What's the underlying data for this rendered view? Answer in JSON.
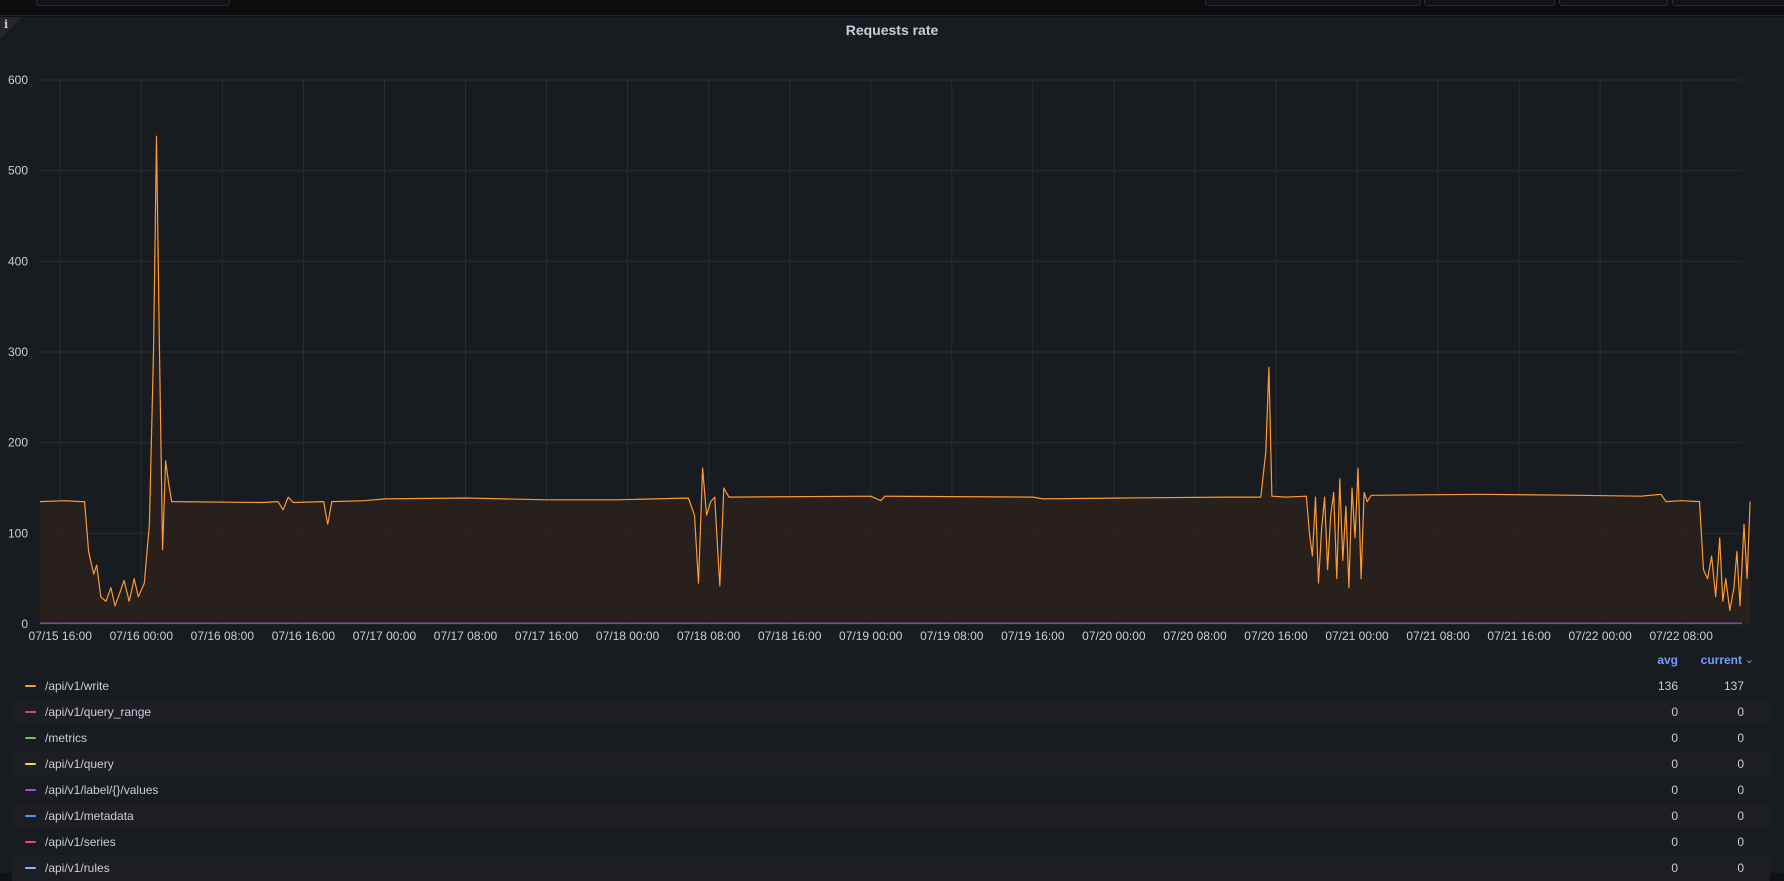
{
  "panel": {
    "title": "Requests rate",
    "info_glyph": "i"
  },
  "legend": {
    "avg_header": "avg",
    "current_header": "current",
    "sort_icon": "chevron-down-icon",
    "rows": [
      {
        "label": "/api/v1/write",
        "color": "#ff9830",
        "avg": "136",
        "current": "137"
      },
      {
        "label": "/api/v1/query_range",
        "color": "#d63e88",
        "avg": "0",
        "current": "0"
      },
      {
        "label": "/metrics",
        "color": "#73bf69",
        "avg": "0",
        "current": "0"
      },
      {
        "label": "/api/v1/query",
        "color": "#fade2a",
        "avg": "0",
        "current": "0"
      },
      {
        "label": "/api/v1/label/{}/values",
        "color": "#a352cc",
        "avg": "0",
        "current": "0"
      },
      {
        "label": "/api/v1/metadata",
        "color": "#5794f2",
        "avg": "0",
        "current": "0"
      },
      {
        "label": "/api/v1/series",
        "color": "#f2495c",
        "avg": "0",
        "current": "0"
      },
      {
        "label": "/api/v1/rules",
        "color": "#8ab8ff",
        "avg": "0",
        "current": "0"
      }
    ]
  },
  "chart_data": {
    "type": "area",
    "title": "Requests rate",
    "ylim": [
      0,
      600
    ],
    "y_ticks": [
      0,
      100,
      200,
      300,
      400,
      500,
      600
    ],
    "x_tick_labels": [
      "07/15 16:00",
      "07/16 00:00",
      "07/16 08:00",
      "07/16 16:00",
      "07/17 00:00",
      "07/17 08:00",
      "07/17 16:00",
      "07/18 00:00",
      "07/18 08:00",
      "07/18 16:00",
      "07/19 00:00",
      "07/19 08:00",
      "07/19 16:00",
      "07/20 00:00",
      "07/20 08:00",
      "07/20 16:00",
      "07/21 00:00",
      "07/21 08:00",
      "07/21 16:00",
      "07/22 00:00",
      "07/22 08:00"
    ],
    "x_range_hours": [
      -2,
      166
    ],
    "grid": true,
    "legend_position": "bottom",
    "series": [
      {
        "name": "/api/v1/write",
        "color": "#ff9830",
        "fill": "#2b211d",
        "points": [
          [
            -2,
            135
          ],
          [
            0.5,
            136
          ],
          [
            2,
            135
          ],
          [
            2.4,
            135
          ],
          [
            2.8,
            80
          ],
          [
            3.3,
            55
          ],
          [
            3.6,
            65
          ],
          [
            4,
            30
          ],
          [
            4.5,
            25
          ],
          [
            5,
            40
          ],
          [
            5.4,
            20
          ],
          [
            5.9,
            35
          ],
          [
            6.3,
            48
          ],
          [
            6.8,
            25
          ],
          [
            7.3,
            50
          ],
          [
            7.7,
            30
          ],
          [
            8.3,
            45
          ],
          [
            8.8,
            110
          ],
          [
            9.2,
            300
          ],
          [
            9.5,
            538
          ],
          [
            9.8,
            300
          ],
          [
            10.1,
            82
          ],
          [
            10.4,
            180
          ],
          [
            10.7,
            155
          ],
          [
            11,
            135
          ],
          [
            20,
            134
          ],
          [
            21.5,
            135
          ],
          [
            22,
            126
          ],
          [
            22.5,
            140
          ],
          [
            23,
            134
          ],
          [
            26,
            135
          ],
          [
            26.4,
            110
          ],
          [
            26.8,
            135
          ],
          [
            30,
            136
          ],
          [
            32,
            138
          ],
          [
            40,
            139
          ],
          [
            48,
            137
          ],
          [
            55,
            137
          ],
          [
            62,
            139
          ],
          [
            62.6,
            120
          ],
          [
            63,
            45
          ],
          [
            63.4,
            172
          ],
          [
            63.8,
            120
          ],
          [
            64.2,
            135
          ],
          [
            64.6,
            140
          ],
          [
            65.1,
            42
          ],
          [
            65.5,
            150
          ],
          [
            66,
            140
          ],
          [
            80,
            141
          ],
          [
            81,
            136
          ],
          [
            81.4,
            141
          ],
          [
            96,
            140
          ],
          [
            97,
            138
          ],
          [
            105,
            139
          ],
          [
            115,
            140
          ],
          [
            118.5,
            140
          ],
          [
            119,
            190
          ],
          [
            119.3,
            283
          ],
          [
            119.6,
            141
          ],
          [
            121,
            140
          ],
          [
            123,
            141
          ],
          [
            123.3,
            100
          ],
          [
            123.6,
            75
          ],
          [
            123.9,
            140
          ],
          [
            124.2,
            45
          ],
          [
            124.5,
            105
          ],
          [
            124.8,
            140
          ],
          [
            125.1,
            60
          ],
          [
            125.4,
            120
          ],
          [
            125.7,
            145
          ],
          [
            126,
            50
          ],
          [
            126.3,
            160
          ],
          [
            126.6,
            70
          ],
          [
            126.9,
            130
          ],
          [
            127.2,
            40
          ],
          [
            127.5,
            150
          ],
          [
            127.8,
            95
          ],
          [
            128.1,
            172
          ],
          [
            128.4,
            50
          ],
          [
            128.7,
            145
          ],
          [
            129,
            135
          ],
          [
            129.4,
            142
          ],
          [
            140,
            143
          ],
          [
            150,
            142
          ],
          [
            156,
            141
          ],
          [
            158,
            143
          ],
          [
            158.5,
            135
          ],
          [
            160,
            136
          ],
          [
            161.8,
            135
          ],
          [
            162.2,
            60
          ],
          [
            162.6,
            50
          ],
          [
            163,
            75
          ],
          [
            163.4,
            30
          ],
          [
            163.8,
            95
          ],
          [
            164.1,
            25
          ],
          [
            164.4,
            50
          ],
          [
            164.8,
            15
          ],
          [
            165.2,
            40
          ],
          [
            165.5,
            80
          ],
          [
            165.8,
            20
          ],
          [
            166.2,
            110
          ],
          [
            166.5,
            50
          ],
          [
            166.8,
            135
          ]
        ]
      }
    ]
  }
}
